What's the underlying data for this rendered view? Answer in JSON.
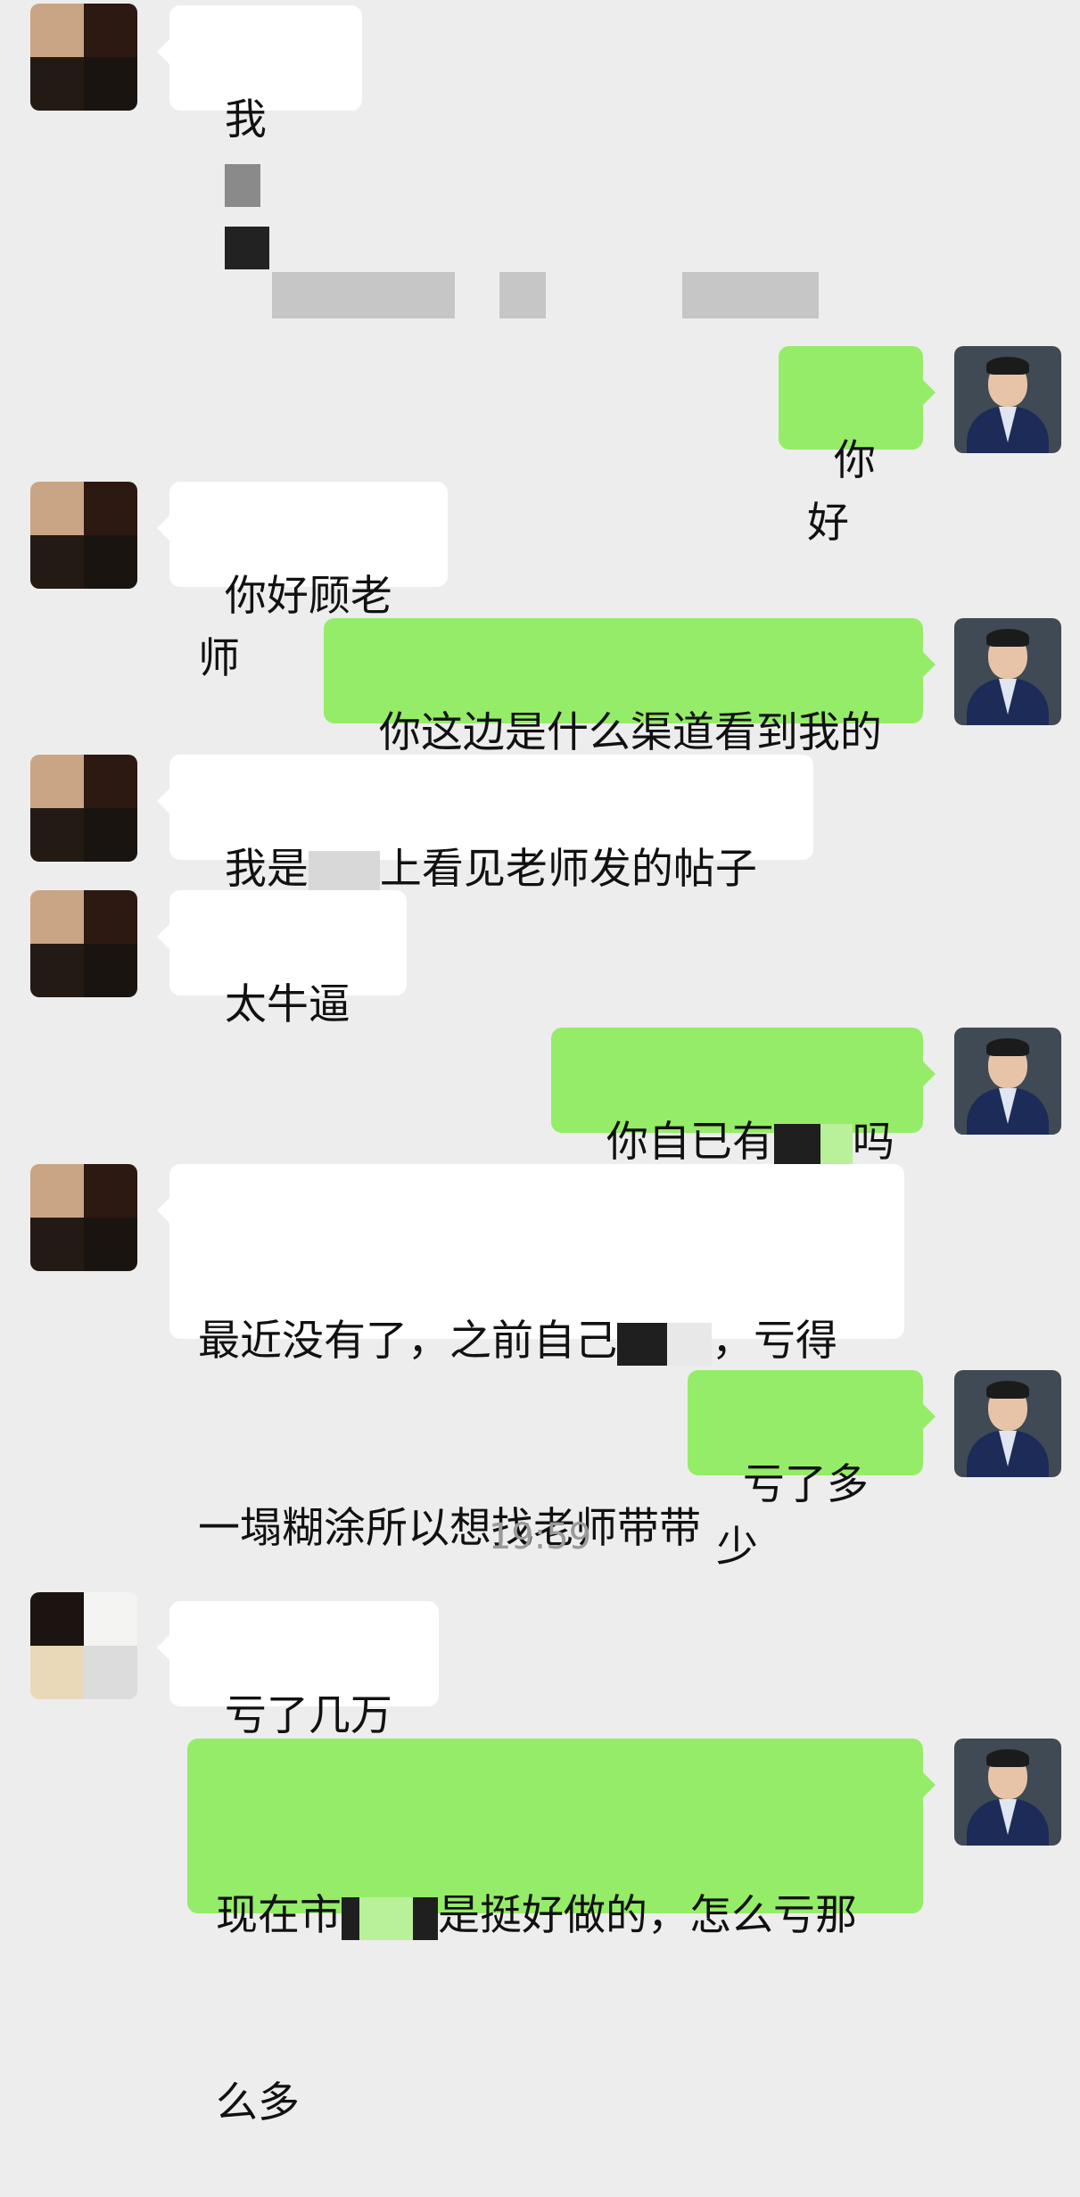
{
  "top_message": {
    "text": "我"
  },
  "messages": [
    {
      "side": "right",
      "text": "你好"
    },
    {
      "side": "left",
      "text": "你好顾老师"
    },
    {
      "side": "right",
      "text": "你这边是什么渠道看到我的"
    },
    {
      "side": "left",
      "text_a": "我是",
      "text_b": "上看见老师发的帖子"
    },
    {
      "side": "left",
      "text": "太牛逼"
    },
    {
      "side": "right",
      "text_a": "你自已有",
      "text_b": "吗"
    },
    {
      "side": "left",
      "line1_a": "最近没有了，之前自己",
      "line1_b": "，亏得",
      "line2": "一塌糊涂所以想找老师带带"
    },
    {
      "side": "right",
      "text": "亏了多少"
    },
    {
      "side": "left",
      "text": "亏了几万 u"
    },
    {
      "side": "right",
      "line1_a": "现在市",
      "line1_b": "是挺好做的，怎么亏那",
      "line2": "么多"
    }
  ],
  "timestamp": "19:59",
  "colors": {
    "background": "#ededed",
    "green_bubble": "#95ec69",
    "white_bubble": "#ffffff"
  }
}
